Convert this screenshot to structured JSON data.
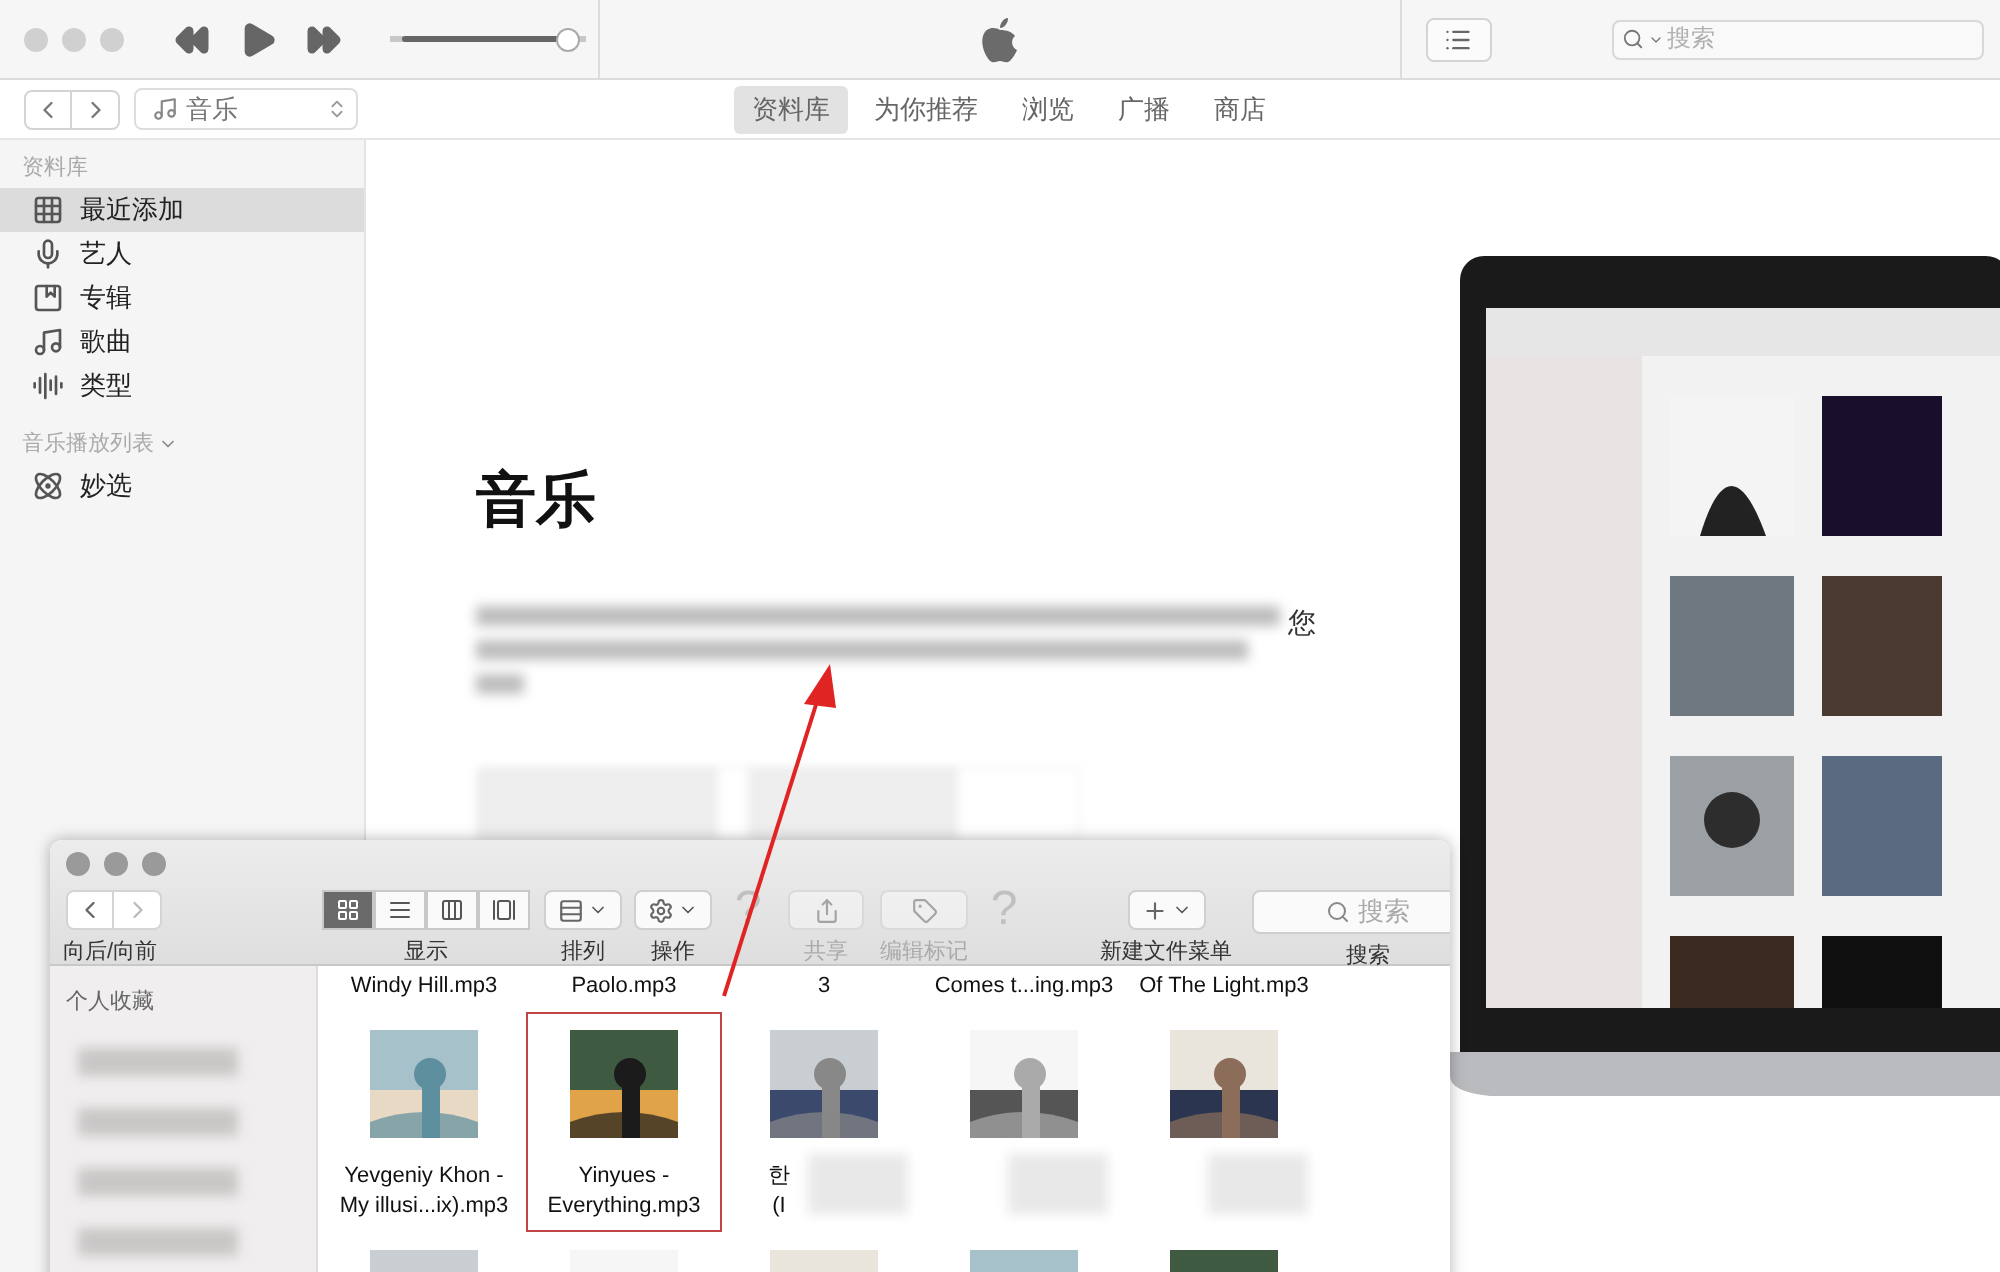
{
  "player": {
    "volume": {
      "level": 0.97
    }
  },
  "search": {
    "placeholder": "搜索"
  },
  "source": {
    "label": "音乐"
  },
  "tabs": [
    {
      "label": "资料库",
      "selected": true
    },
    {
      "label": "为你推荐",
      "selected": false
    },
    {
      "label": "浏览",
      "selected": false
    },
    {
      "label": "广播",
      "selected": false
    },
    {
      "label": "商店",
      "selected": false
    }
  ],
  "sidebar": {
    "sections": [
      {
        "heading": "资料库",
        "items": [
          {
            "label": "最近添加",
            "kind": "recent",
            "selected": true
          },
          {
            "label": "艺人",
            "kind": "artist",
            "selected": false
          },
          {
            "label": "专辑",
            "kind": "album",
            "selected": false
          },
          {
            "label": "歌曲",
            "kind": "song",
            "selected": false
          },
          {
            "label": "类型",
            "kind": "genre",
            "selected": false
          }
        ]
      },
      {
        "heading": "音乐播放列表",
        "collapsible": true,
        "items": [
          {
            "label": "妙选",
            "kind": "genius",
            "selected": false
          }
        ]
      }
    ]
  },
  "main": {
    "title": "音乐",
    "paragraph_visible": "您"
  },
  "finder": {
    "nav_label": "向后/向前",
    "toolbar": [
      {
        "kind": "views",
        "label": "显示"
      },
      {
        "kind": "arrange",
        "label": "排列",
        "disabled": false
      },
      {
        "kind": "action",
        "label": "操作",
        "disabled": false
      },
      {
        "kind": "missing",
        "glyph": "?"
      },
      {
        "kind": "share",
        "label": "共享",
        "disabled": true
      },
      {
        "kind": "tag",
        "label": "编辑标记",
        "disabled": true
      },
      {
        "kind": "missing",
        "glyph": "?"
      },
      {
        "kind": "new",
        "label": "新建文件菜单",
        "disabled": false
      },
      {
        "kind": "search",
        "label": "搜索",
        "placeholder": "搜索"
      }
    ],
    "sidebar": {
      "heading": "个人收藏",
      "items": [
        {
          "kind": "blurred"
        },
        {
          "kind": "blurred"
        },
        {
          "kind": "blurred"
        },
        {
          "kind": "blurred"
        }
      ]
    },
    "rows": [
      {
        "kind": "names",
        "items": [
          {
            "label": "Windy Hill.mp3"
          },
          {
            "label": "Paolo.mp3"
          },
          {
            "label": "3"
          },
          {
            "label": "Comes t...ing.mp3"
          },
          {
            "label": "Of The Light.mp3"
          }
        ]
      },
      {
        "kind": "files",
        "items": [
          {
            "label": "Yevgeniy Khon -\nMy illusi...ix).mp3",
            "selected": false,
            "blurred": false
          },
          {
            "label": "Yinyues -\nEverything.mp3",
            "selected": true,
            "blurred": false
          },
          {
            "label": "한\n(I",
            "selected": false,
            "blurred": true
          },
          {
            "selected": false,
            "blurred": true
          },
          {
            "selected": false,
            "blurred": true
          }
        ]
      },
      {
        "kind": "thumbs"
      }
    ]
  }
}
